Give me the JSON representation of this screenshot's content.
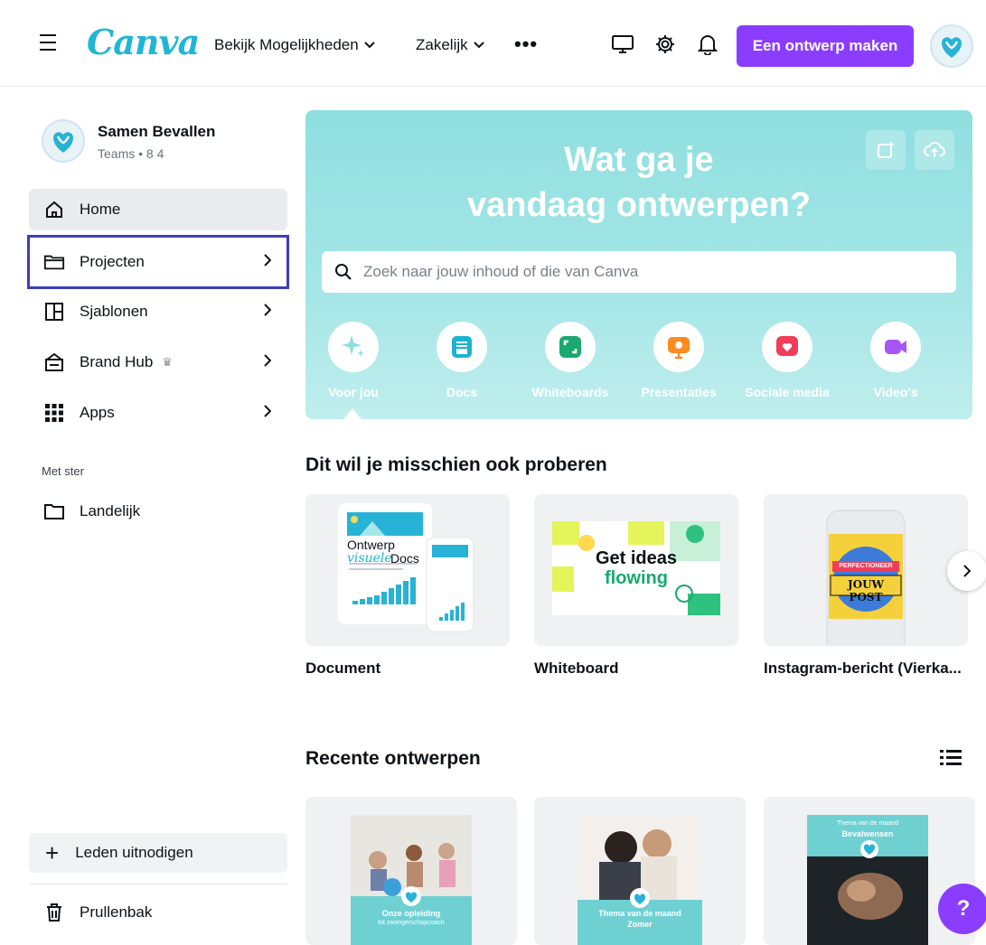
{
  "header": {
    "logo": "Canva",
    "nav": [
      {
        "label": "Bekijk Mogelijkheden"
      },
      {
        "label": "Zakelijk"
      }
    ],
    "cta_label": "Een ontwerp maken"
  },
  "sidebar": {
    "team_name": "Samen Bevallen",
    "team_sub": "Teams • 8 4",
    "items": [
      {
        "label": "Home",
        "icon": "home-icon"
      },
      {
        "label": "Projecten",
        "icon": "folder-icon"
      },
      {
        "label": "Sjablonen",
        "icon": "template-icon"
      },
      {
        "label": "Brand Hub",
        "icon": "brand-icon"
      },
      {
        "label": "Apps",
        "icon": "apps-grid-icon"
      }
    ],
    "starred_label": "Met ster",
    "starred": [
      {
        "label": "Landelijk",
        "icon": "folder-icon"
      }
    ],
    "invite_label": "Leden uitnodigen",
    "trash_label": "Prullenbak"
  },
  "hero": {
    "title_line1": "Wat ga je",
    "title_line2": "vandaag ontwerpen?",
    "search_placeholder": "Zoek naar jouw inhoud of die van Canva",
    "categories": [
      {
        "label": "Voor jou",
        "color": "#8fdfe0"
      },
      {
        "label": "Docs",
        "color": "#1bb3d4"
      },
      {
        "label": "Whiteboards",
        "color": "#1aa870"
      },
      {
        "label": "Presentaties",
        "color": "#ff8a1f"
      },
      {
        "label": "Sociale media",
        "color": "#ef3d5a"
      },
      {
        "label": "Video's",
        "color": "#a855f7"
      }
    ]
  },
  "suggestions": {
    "title": "Dit wil je misschien ook proberen",
    "items": [
      {
        "label": "Document",
        "thumb_title": "Ontwerp",
        "thumb_accent": "visuele",
        "thumb_word": "Docs"
      },
      {
        "label": "Whiteboard",
        "thumb_line1": "Get ideas",
        "thumb_line2": "flowing"
      },
      {
        "label": "Instagram-bericht (Vierka...",
        "thumb_badge": "PERFECTIONEER",
        "thumb_text": "JOUW POST"
      }
    ]
  },
  "recent": {
    "title": "Recente ontwerpen",
    "items": [
      {
        "caption1": "Onze opleiding",
        "caption2": "tot zwangerschapcoach"
      },
      {
        "caption1": "Thema van de maand",
        "caption2": "Zomer"
      },
      {
        "caption1": "Thema van de maand",
        "caption2": "Bevalwensen"
      }
    ]
  },
  "help_label": "?",
  "colors": {
    "accent": "#8b3dff",
    "brand": "#1fb6d6",
    "hero": "#a6e6e6",
    "outline": "#3a3fbd"
  }
}
